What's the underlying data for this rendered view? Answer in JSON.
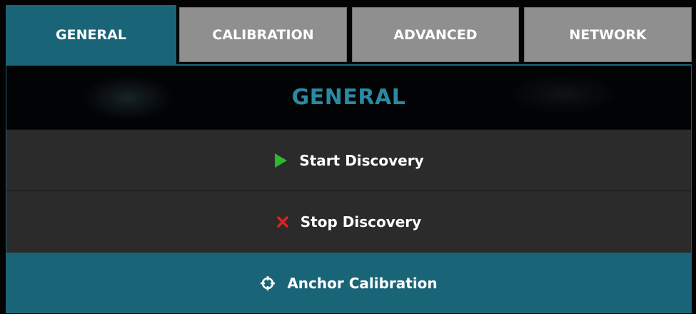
{
  "tabs": [
    {
      "label": "GENERAL",
      "active": true
    },
    {
      "label": "CALIBRATION",
      "active": false
    },
    {
      "label": "ADVANCED",
      "active": false
    },
    {
      "label": "NETWORK",
      "active": false
    }
  ],
  "panel": {
    "title": "GENERAL",
    "buttons": [
      {
        "label": "Start Discovery",
        "icon": "play-icon",
        "icon_color": "#2db82d"
      },
      {
        "label": "Stop Discovery",
        "icon": "close-icon",
        "icon_color": "#e02020"
      },
      {
        "label": "Anchor Calibration",
        "icon": "crosshair-icon",
        "icon_color": "#ffffff"
      }
    ]
  },
  "colors": {
    "accent": "#1a6478",
    "title": "#2a8aa1",
    "inactive_tab": "#8f8f8f",
    "row_dark": "#2b2b2b"
  }
}
